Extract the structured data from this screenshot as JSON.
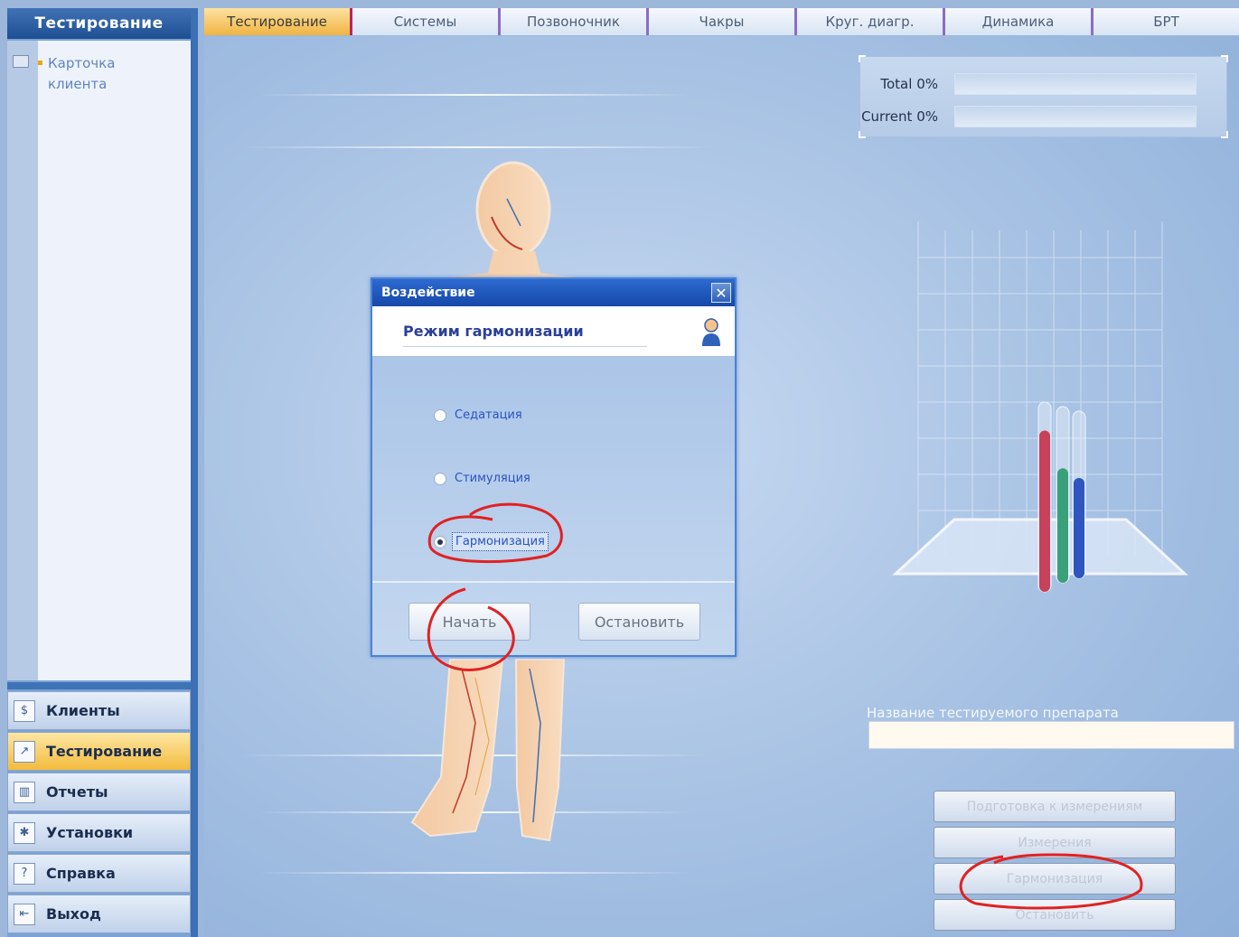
{
  "sidebar": {
    "header": "Тестирование",
    "tree_items": [
      {
        "label": "Карточка клиента"
      }
    ],
    "nav": [
      {
        "label": "Клиенты",
        "icon": "client-icon",
        "active": false
      },
      {
        "label": "Тестирование",
        "icon": "testing-icon",
        "active": true
      },
      {
        "label": "Отчеты",
        "icon": "reports-icon",
        "active": false
      },
      {
        "label": "Установки",
        "icon": "settings-icon",
        "active": false
      },
      {
        "label": "Справка",
        "icon": "help-icon",
        "active": false
      },
      {
        "label": "Выход",
        "icon": "exit-icon",
        "active": false
      }
    ]
  },
  "tabs": [
    {
      "label": "Тестирование",
      "active": true
    },
    {
      "label": "Системы"
    },
    {
      "label": "Позвоночник"
    },
    {
      "label": "Чакры"
    },
    {
      "label": "Круг. диагр."
    },
    {
      "label": "Динамика"
    },
    {
      "label": "БРТ"
    }
  ],
  "progress": {
    "total_label": "Total",
    "total_value": "0%",
    "current_label": "Current",
    "current_value": "0%"
  },
  "drug": {
    "label": "Название тестируемого препарата",
    "value": ""
  },
  "actions": {
    "prepare": "Подготовка к измерениям",
    "measure": "Измерения",
    "harmonize": "Гармонизация",
    "stop": "Остановить"
  },
  "dialog": {
    "title": "Воздействие",
    "header": "Режим гармонизации",
    "options": [
      {
        "label": "Седатация",
        "checked": false
      },
      {
        "label": "Стимуляция",
        "checked": false
      },
      {
        "label": "Гармонизация",
        "checked": true
      }
    ],
    "start_button": "Начать",
    "stop_button": "Остановить"
  },
  "tubes": {
    "red": 0.85,
    "green": 0.65,
    "blue": 0.6
  }
}
